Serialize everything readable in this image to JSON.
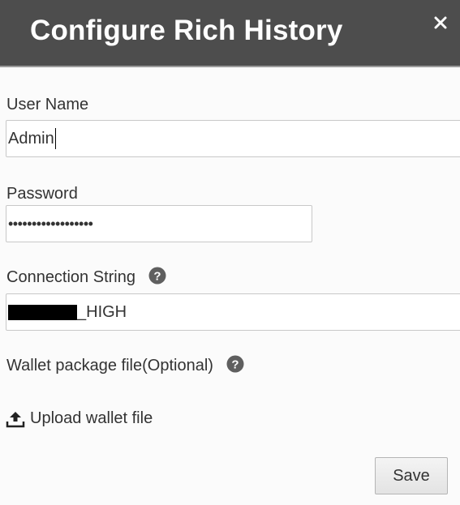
{
  "dialog": {
    "title": "Configure Rich History",
    "close_label": "×"
  },
  "form": {
    "user_name": {
      "label": "User Name",
      "value": "Admin"
    },
    "password": {
      "label": "Password",
      "value": "••••••••••••••••••"
    },
    "connection_string": {
      "label": "Connection String",
      "value_suffix": "_HIGH"
    },
    "wallet": {
      "label": "Wallet package file(Optional)",
      "upload_label": "Upload wallet file"
    }
  },
  "actions": {
    "save_label": "Save"
  },
  "icons": {
    "close": "close-icon",
    "help": "help-icon",
    "upload": "upload-icon"
  },
  "colors": {
    "header_bg": "#4d4d4d",
    "header_text": "#ffffff",
    "help_icon": "#5f5f5f"
  }
}
